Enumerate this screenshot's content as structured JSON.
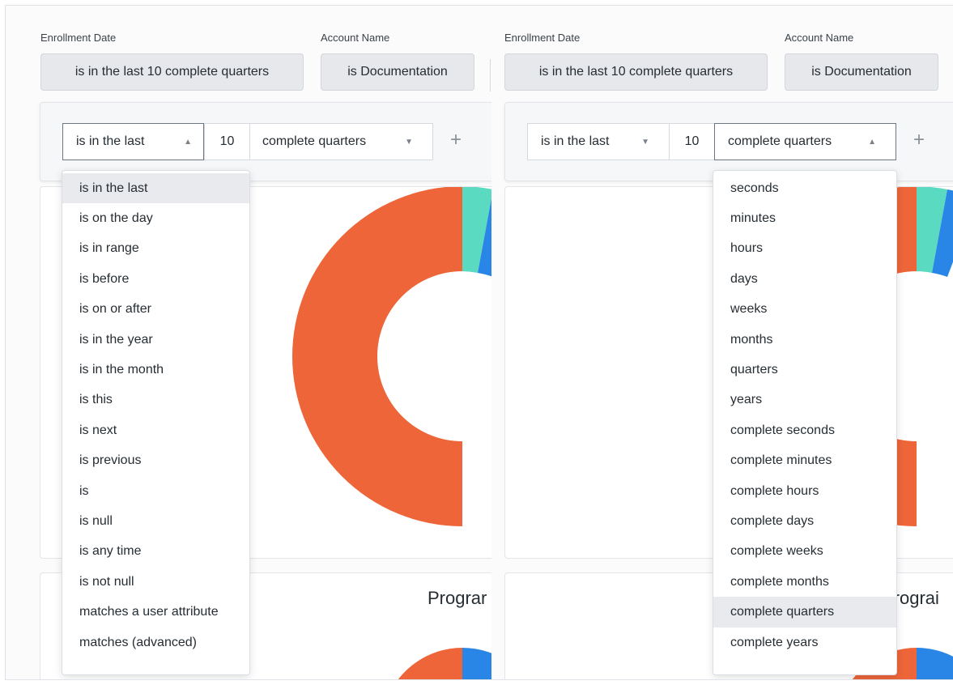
{
  "left_pane": {
    "filters": [
      {
        "label": "Enrollment Date",
        "value": "is in the last 10 complete quarters"
      },
      {
        "label": "Account Name",
        "value": "is Documentation"
      }
    ],
    "editor": {
      "operator": "is in the last",
      "number": "10",
      "unit": "complete quarters",
      "add": "+",
      "operator_open": true,
      "unit_open": false
    },
    "second_card_title": "Prograr",
    "operator_options": [
      "is in the last",
      "is on the day",
      "is in range",
      "is before",
      "is on or after",
      "is in the year",
      "is in the month",
      "is this",
      "is next",
      "is previous",
      "is",
      "is null",
      "is any time",
      "is not null",
      "matches a user attribute",
      "matches (advanced)"
    ],
    "selected_operator_index": 0
  },
  "right_pane": {
    "filters": [
      {
        "label": "Enrollment Date",
        "value": "is in the last 10 complete quarters"
      },
      {
        "label": "Account Name",
        "value": "is Documentation"
      }
    ],
    "editor": {
      "operator": "is in the last",
      "number": "10",
      "unit": "complete quarters",
      "add": "+",
      "operator_open": false,
      "unit_open": true
    },
    "second_card_title": "Prograi",
    "unit_options": [
      "seconds",
      "minutes",
      "hours",
      "days",
      "weeks",
      "months",
      "quarters",
      "years",
      "complete seconds",
      "complete minutes",
      "complete hours",
      "complete days",
      "complete weeks",
      "complete months",
      "complete quarters",
      "complete years"
    ],
    "selected_unit_index": 14
  },
  "icons": {
    "caret_up": "▲",
    "caret_down": "▼"
  },
  "colors": {
    "donut_orange": "#ee6539",
    "donut_teal": "#5adac0",
    "donut_blue": "#2a86e6",
    "selected_row": "#e8eaed",
    "chip_bg": "#e6e8eb"
  }
}
